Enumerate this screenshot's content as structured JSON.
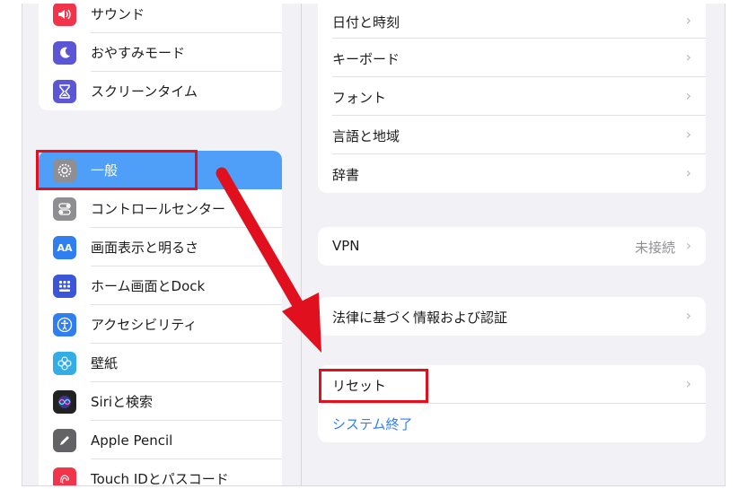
{
  "sidebar": {
    "top_items": [
      {
        "label": "サウンド",
        "icon": "speaker-icon",
        "color": "#f2344a"
      },
      {
        "label": "おやすみモード",
        "icon": "moon-icon",
        "color": "#5a56d6"
      },
      {
        "label": "スクリーンタイム",
        "icon": "hourglass-icon",
        "color": "#5a56d6"
      }
    ],
    "main_items": [
      {
        "label": "一般",
        "icon": "gear-icon",
        "color": "#8e8e93",
        "active": true
      },
      {
        "label": "コントロールセンター",
        "icon": "toggle-icon",
        "color": "#8e8e93"
      },
      {
        "label": "画面表示と明るさ",
        "icon": "text-size-icon",
        "color": "#2f7ff0",
        "glyph": "AA"
      },
      {
        "label": "ホーム画面とDock",
        "icon": "grid-icon",
        "color": "#3b56d6"
      },
      {
        "label": "アクセシビリティ",
        "icon": "accessibility-icon",
        "color": "#2f7ff0"
      },
      {
        "label": "壁紙",
        "icon": "flower-icon",
        "color": "#32ade6"
      },
      {
        "label": "Siriと検索",
        "icon": "siri-icon",
        "color": "#222222"
      },
      {
        "label": "Apple Pencil",
        "icon": "pencil-icon",
        "color": "#636366"
      },
      {
        "label": "Touch IDとパスコード",
        "icon": "fingerprint-icon",
        "color": "#f2344a"
      }
    ]
  },
  "detail": {
    "group1": [
      "日付と時刻",
      "キーボード",
      "フォント",
      "言語と地域",
      "辞書"
    ],
    "vpn": {
      "label": "VPN",
      "value": "未接続"
    },
    "legal": "法律に基づく情報および認証",
    "reset": "リセット",
    "shutdown": "システム終了"
  },
  "colors": {
    "accent": "#4f9ef8",
    "highlight": "#e0101e",
    "link": "#2f7ff0"
  }
}
